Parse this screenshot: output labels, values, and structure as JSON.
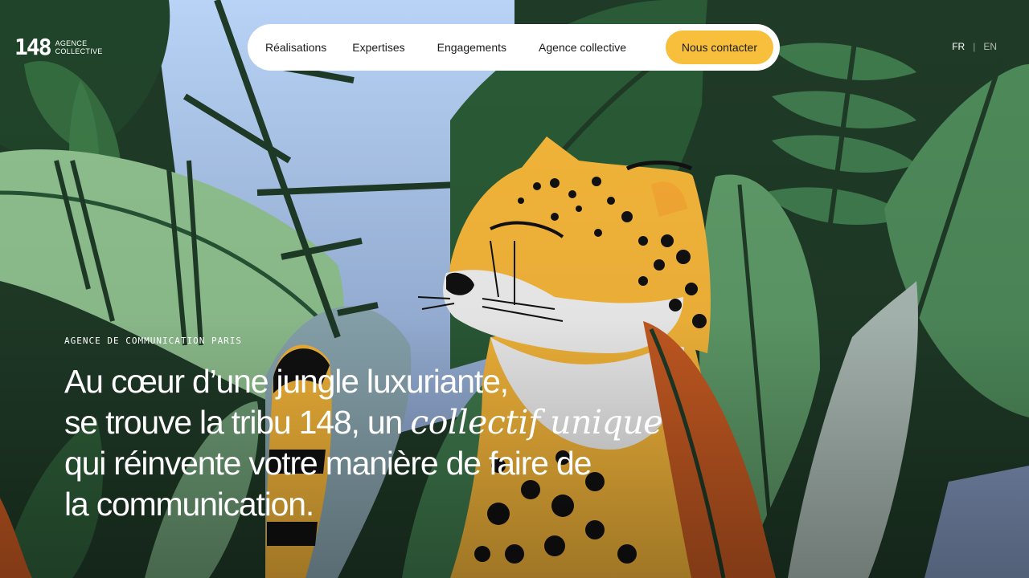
{
  "logo": {
    "number": "148",
    "line1": "AGENCE",
    "line2": "COLLECTIVE"
  },
  "nav": {
    "items": [
      {
        "label": "Réalisations"
      },
      {
        "label": "Expertises"
      },
      {
        "label": "Engagements"
      },
      {
        "label": "Agence collective"
      }
    ],
    "cta_label": "Nous contacter"
  },
  "lang": {
    "fr": "FR",
    "separator": "|",
    "en": "EN"
  },
  "hero": {
    "eyebrow": "AGENCE DE COMMUNICATION PARIS",
    "line1": "Au cœur d’une jungle luxuriante,",
    "line2_start": "se trouve la tribu 148, un ",
    "line2_emphasis": "collectif unique",
    "line3": "qui réinvente votre manière de faire de",
    "line4": "la communication."
  },
  "colors": {
    "accent": "#f8bf3c",
    "nav_bg": "#ffffff",
    "text_light": "#ffffff",
    "sky": "#b9d2f5",
    "jungle_dark": "#1f3a27",
    "leaf_light": "#8dbd8e",
    "leaf_orange": "#c65a22",
    "cheetah": "#f5b63a"
  }
}
